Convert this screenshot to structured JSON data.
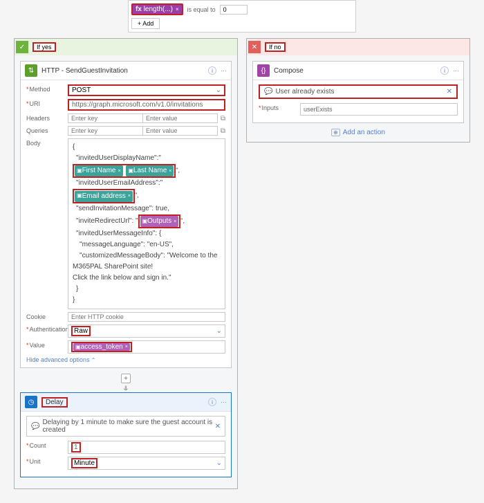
{
  "condition": {
    "fx_label": "fx",
    "fx_value": "length(...)",
    "operator": "is equal to",
    "value": "0",
    "add_btn": "+  Add"
  },
  "yes": {
    "header": "If yes",
    "http": {
      "title": "HTTP - SendGuestInvitation",
      "labels": {
        "method": "Method",
        "uri": "URI",
        "headers": "Headers",
        "queries": "Queries",
        "body": "Body",
        "cookie": "Cookie",
        "auth": "Authentication",
        "value": "Value"
      },
      "method": "POST",
      "uri": "https://graph.microsoft.com/v1.0/invitations",
      "key_ph": "Enter key",
      "val_ph": "Enter value",
      "cookie_ph": "Enter HTTP cookie",
      "auth": "Raw",
      "body": {
        "l1": "{",
        "l2": "\"invitedUserDisplayName\":\"",
        "chip_first": "First Name",
        "chip_last": "Last Name",
        "l3": "\"invitedUserEmailAddress\":\"",
        "chip_email": "Email address",
        "l4": "\"sendInvitationMessage\": true,",
        "l5": "\"inviteRedirectUrl\": \"",
        "chip_outputs": "Outputs",
        "l6": "\"invitedUserMessageInfo\": {",
        "l7": "\"messageLanguage\": \"en-US\",",
        "l8": "\"customizedMessageBody\": \"Welcome to the M365PAL SharePoint site!",
        "l9": "Click the link below and sign in.\"",
        "l10": "}",
        "l11": "}"
      },
      "value_chip": "access_token",
      "adv": "Hide advanced options"
    },
    "delay": {
      "title": "Delay",
      "comment": "Delaying by 1 minute to make sure the guest account is created",
      "labels": {
        "count": "Count",
        "unit": "Unit"
      },
      "count": "1",
      "unit": "Minute"
    }
  },
  "no": {
    "header": "If no",
    "compose": {
      "title": "Compose",
      "comment": "User already exists",
      "labels": {
        "inputs": "Inputs"
      },
      "value": "userExists"
    },
    "add_action": "Add an action"
  }
}
